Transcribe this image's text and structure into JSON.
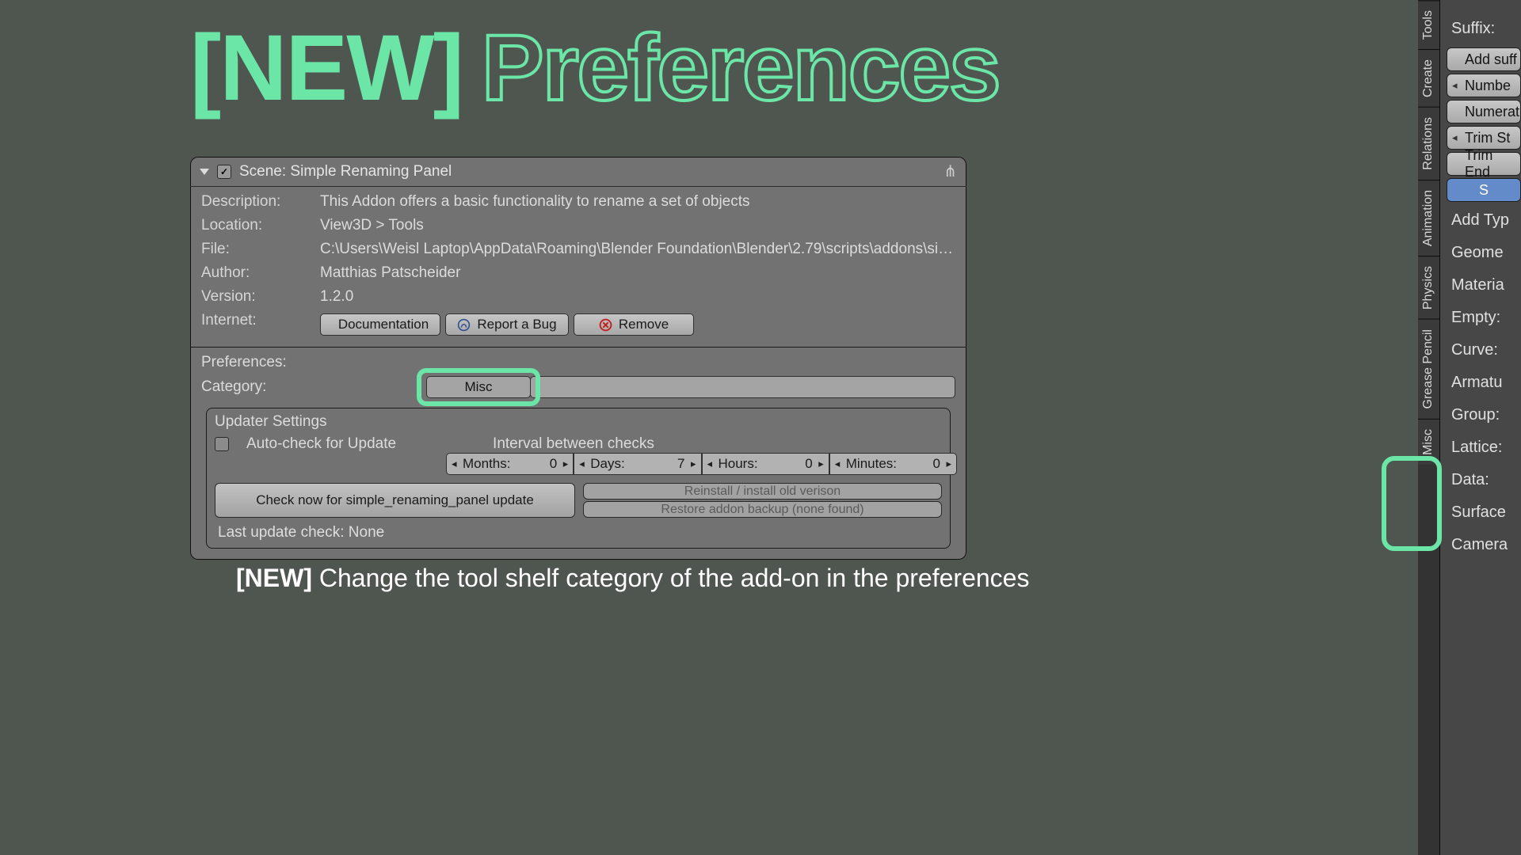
{
  "title": {
    "tag": "[NEW]",
    "word": "Preferences"
  },
  "panel": {
    "title": "Scene: Simple Renaming Panel",
    "enabled": true,
    "description_label": "Description:",
    "description": "This Addon offers a basic functionality to rename a set of objects",
    "location_label": "Location:",
    "location": "View3D > Tools",
    "file_label": "File:",
    "file": "C:\\Users\\Weisl Laptop\\AppData\\Roaming\\Blender Foundation\\Blender\\2.79\\scripts\\addons\\simple_renaming_panel\\__ini...",
    "author_label": "Author:",
    "author": "Matthias Patscheider",
    "version_label": "Version:",
    "version": "1.2.0",
    "internet_label": "Internet:",
    "doc_btn": "Documentation",
    "bug_btn": "Report a Bug",
    "remove_btn": "Remove",
    "prefs_label": "Preferences:",
    "category_label": "Category:",
    "category_value": "Misc",
    "updater": {
      "heading": "Updater Settings",
      "auto_label": "Auto-check for Update",
      "auto_on": false,
      "interval_label": "Interval between checks",
      "months_label": "Months:",
      "months": "0",
      "days_label": "Days:",
      "days": "7",
      "hours_label": "Hours:",
      "hours": "0",
      "minutes_label": "Minutes:",
      "minutes": "0",
      "check_btn": "Check now for simple_renaming_panel update",
      "reinstall_btn": "Reinstall / install old verison",
      "restore_btn": "Restore addon backup (none found)",
      "last_check": "Last update check: None"
    }
  },
  "caption": {
    "tag": "[NEW]",
    "text": "Change the tool shelf category of the add-on in the preferences"
  },
  "side": {
    "tabs": [
      "Tools",
      "Create",
      "Relations",
      "Animation",
      "Physics",
      "Grease Pencil",
      "Misc"
    ],
    "suffix_label": "Suffix:",
    "add_suffix_btn": "Add suff",
    "number_btn": "Numbe",
    "numerate_btn": "Numerat",
    "trim_start_btn": "Trim St",
    "trim_end_btn": "Trim End",
    "blue_btn": "S",
    "rows": [
      "Add Typ",
      "Geome",
      "Materia",
      "Empty:",
      "Curve:",
      "Armatu",
      "Group:",
      "Lattice:",
      "Data:",
      "Surface",
      "Camera"
    ]
  }
}
